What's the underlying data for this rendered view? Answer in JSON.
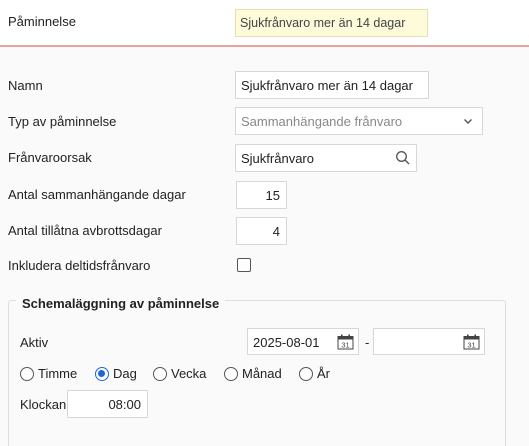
{
  "header": {
    "label": "Påminnelse",
    "value": "Sjukfrånvaro mer än 14 dagar"
  },
  "form": {
    "name": {
      "label": "Namn",
      "value": "Sjukfrånvaro mer än 14 dagar"
    },
    "type": {
      "label": "Typ av påminnelse",
      "value": "Sammanhängande frånvaro"
    },
    "reason": {
      "label": "Frånvaroorsak",
      "value": "Sjukfrånvaro"
    },
    "consecutive_days": {
      "label": "Antal sammanhängande dagar",
      "value": "15"
    },
    "allowed_break_days": {
      "label": "Antal tillåtna avbrottsdagar",
      "value": "4"
    },
    "include_part_time": {
      "label": "Inkludera deltidsfrånvaro",
      "checked": false
    }
  },
  "schedule": {
    "legend": "Schemaläggning av påminnelse",
    "active_label": "Aktiv",
    "start_date": "2025-08-01",
    "separator": "-",
    "end_date": "",
    "calendar_day": "31",
    "intervals": [
      {
        "label": "Timme",
        "checked": false
      },
      {
        "label": "Dag",
        "checked": true
      },
      {
        "label": "Vecka",
        "checked": false
      },
      {
        "label": "Månad",
        "checked": false
      },
      {
        "label": "År",
        "checked": false
      }
    ],
    "time_label": "Klockan",
    "time_value": "08:00"
  },
  "colors": {
    "accent_line": "#e8a49a",
    "highlight_bg": "#fdfbd9",
    "radio_selected": "#1a6ad6"
  }
}
